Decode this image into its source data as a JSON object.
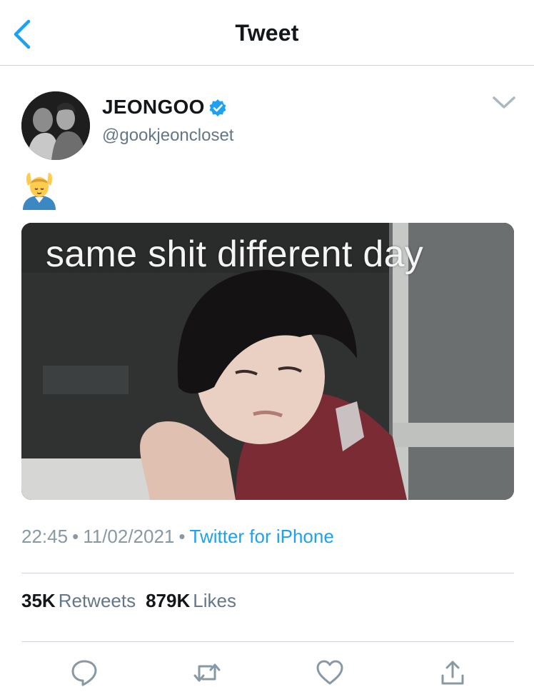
{
  "header": {
    "title": "Tweet"
  },
  "tweet": {
    "author": {
      "name": "JEONGOO",
      "handle": "@gookjeoncloset",
      "verified": true
    },
    "text_emoji": "💆‍♂️",
    "media": {
      "caption": "same shit different day"
    },
    "time": "22:45",
    "date": "11/02/2021",
    "source": "Twitter for iPhone",
    "separator": "•",
    "stats": {
      "retweets_count": "35K",
      "retweets_label": "Retweets",
      "likes_count": "879K",
      "likes_label": "Likes"
    }
  },
  "icons": {
    "back": "chevron-left-icon",
    "caret": "chevron-down-icon",
    "verified": "verified-badge-icon",
    "reply": "reply-icon",
    "retweet": "retweet-icon",
    "like": "heart-icon",
    "share": "share-icon"
  },
  "colors": {
    "accent": "#1da1f2",
    "secondary_text": "#657786",
    "meta_text": "#8899a6",
    "divider": "#cfd5da"
  }
}
